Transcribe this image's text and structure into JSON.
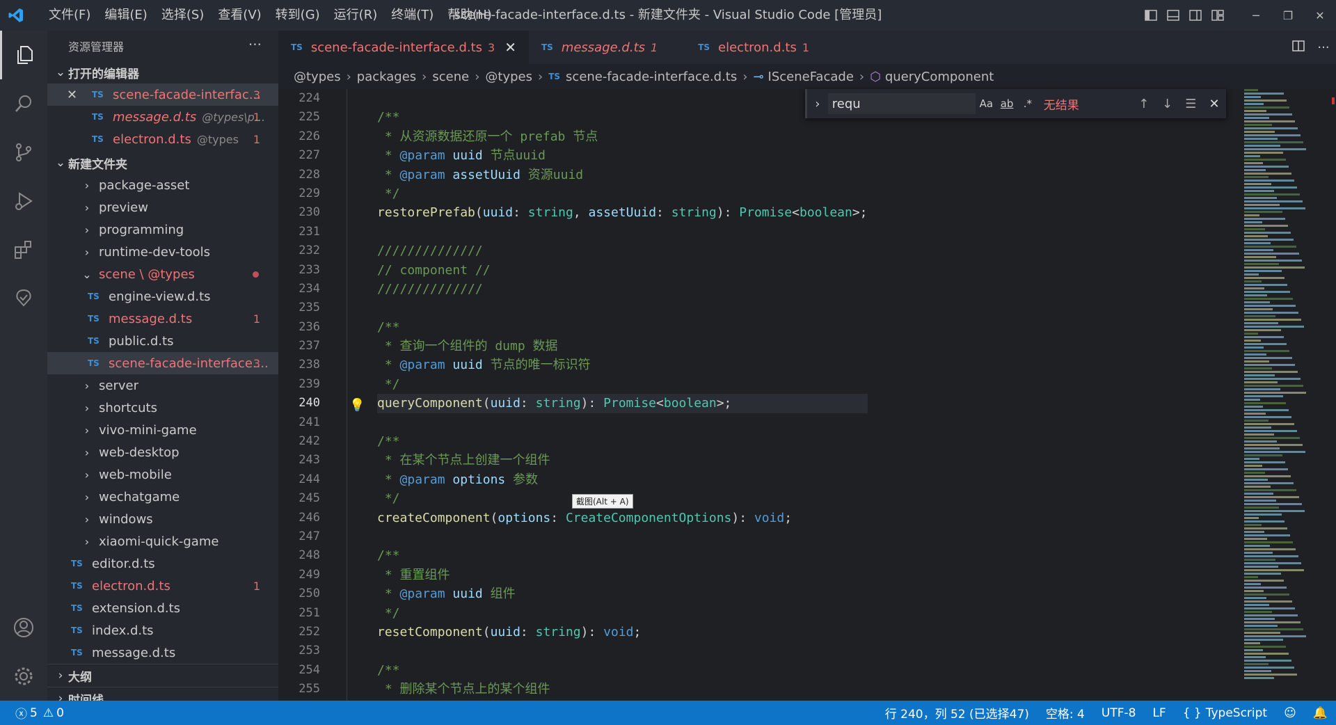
{
  "window": {
    "title": "scene-facade-interface.d.ts - 新建文件夹 - Visual Studio Code [管理员]"
  },
  "menu": [
    "文件(F)",
    "编辑(E)",
    "选择(S)",
    "查看(V)",
    "转到(G)",
    "运行(R)",
    "终端(T)",
    "帮助(H)"
  ],
  "sidebar": {
    "header": "资源管理器",
    "open_editors_title": "打开的编辑器",
    "open_editors": [
      {
        "name": "scene-facade-interfac...",
        "path": "",
        "badge": "3"
      },
      {
        "name": "message.d.ts",
        "path": "@types\\p...",
        "badge": "1"
      },
      {
        "name": "electron.d.ts",
        "path": "@types",
        "badge": "1"
      }
    ],
    "folder_title": "新建文件夹",
    "folders": [
      "package-asset",
      "preview",
      "programming",
      "runtime-dev-tools"
    ],
    "scene_folder": "scene \\ @types",
    "scene_files": [
      {
        "name": "engine-view.d.ts",
        "badge": ""
      },
      {
        "name": "message.d.ts",
        "badge": "1"
      },
      {
        "name": "public.d.ts",
        "badge": ""
      },
      {
        "name": "scene-facade-interface....",
        "badge": "3"
      }
    ],
    "folders2": [
      "server",
      "shortcuts",
      "vivo-mini-game",
      "web-desktop",
      "web-mobile",
      "wechatgame",
      "windows",
      "xiaomi-quick-game"
    ],
    "root_files": [
      {
        "name": "editor.d.ts",
        "badge": ""
      },
      {
        "name": "electron.d.ts",
        "badge": "1"
      },
      {
        "name": "extension.d.ts",
        "badge": ""
      },
      {
        "name": "index.d.ts",
        "badge": ""
      },
      {
        "name": "message.d.ts",
        "badge": ""
      }
    ],
    "outline_title": "大纲",
    "timeline_title": "时间线"
  },
  "tabs": [
    {
      "name": "scene-facade-interface.d.ts",
      "badge": "3"
    },
    {
      "name": "message.d.ts",
      "badge": "1"
    },
    {
      "name": "electron.d.ts",
      "badge": "1"
    }
  ],
  "breadcrumb": [
    "@types",
    "packages",
    "scene",
    "@types",
    "scene-facade-interface.d.ts",
    "ISceneFacade",
    "queryComponent"
  ],
  "find": {
    "query": "requ",
    "opt_case": "Aa",
    "opt_word": "ab",
    "opt_regex": ".*",
    "no_results": "无结果"
  },
  "editor": {
    "line_numbers": [
      "224",
      "225",
      "226",
      "227",
      "228",
      "229",
      "230",
      "231",
      "232",
      "233",
      "234",
      "235",
      "236",
      "237",
      "238",
      "239",
      "240",
      "241",
      "242",
      "243",
      "244",
      "245",
      "246",
      "247",
      "248",
      "249",
      "250",
      "251",
      "252",
      "253",
      "254",
      "255"
    ],
    "current_line": "240",
    "tooltip": "截图(Alt + A)"
  },
  "status": {
    "errors": "5",
    "warnings": "0",
    "position": "行 240，列 52 (已选择47)",
    "spaces": "空格: 4",
    "encoding": "UTF-8",
    "eol": "LF",
    "language": "TypeScript"
  },
  "colors": {
    "statusbar": "#0d74c8",
    "error": "#f07474",
    "ts_icon": "#3d8fd6"
  }
}
